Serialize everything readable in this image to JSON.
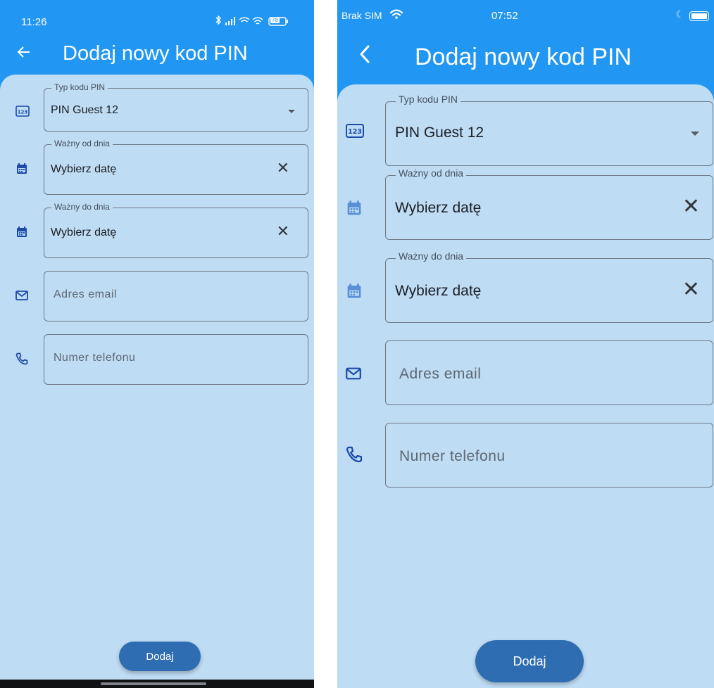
{
  "android": {
    "status": {
      "time": "11:26",
      "battery": "78"
    },
    "appbar": {
      "title": "Dodaj nowy kod PIN",
      "back_icon": "arrow-left-icon"
    },
    "fields": {
      "pin_type": {
        "label": "Typ kodu PIN",
        "value": "PIN Guest 12"
      },
      "valid_from": {
        "label": "Ważny od dnia",
        "value": "Wybierz datę"
      },
      "valid_to": {
        "label": "Ważny do dnia",
        "value": "Wybierz datę"
      },
      "email": {
        "placeholder": "Adres email"
      },
      "phone": {
        "placeholder": "Numer telefonu"
      }
    },
    "submit_label": "Dodaj"
  },
  "ios": {
    "status": {
      "carrier": "Brak SIM",
      "time": "07:52"
    },
    "appbar": {
      "title": "Dodaj nowy kod PIN",
      "back_icon": "chevron-left-icon"
    },
    "fields": {
      "pin_type": {
        "label": "Typ kodu PIN",
        "value": "PIN Guest 12"
      },
      "valid_from": {
        "label": "Ważny od dnia",
        "value": "Wybierz datę"
      },
      "valid_to": {
        "label": "Ważny do dnia",
        "value": "Wybierz datę"
      },
      "email": {
        "placeholder": "Adres email"
      },
      "phone": {
        "placeholder": "Numer telefonu"
      }
    },
    "submit_label": "Dodaj"
  },
  "colors": {
    "appbar": "#2196f3",
    "background": "#bedcf4",
    "button": "#2f6db3",
    "icon_dark": "#1b4aa8",
    "icon_light": "#5a8fd6"
  }
}
